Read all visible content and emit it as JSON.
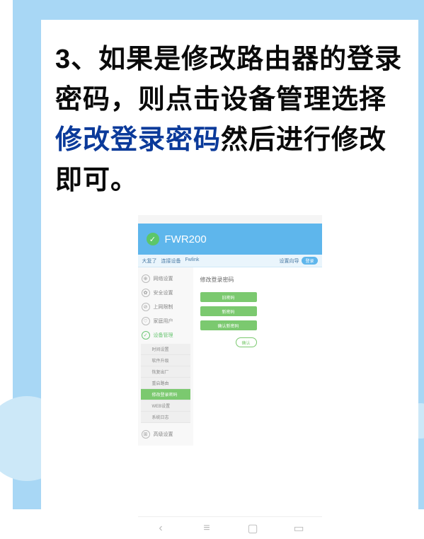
{
  "instruction": {
    "prefix": "3、如果是修改路由器的登录密码，则点击设备管理选择",
    "highlight": "修改登录密码",
    "suffix": "然后进行修改即可。"
  },
  "screenshot": {
    "device_name": "FWR200",
    "nav_left_1": "大复了",
    "nav_left_2": "连接设备",
    "nav_left_3": "Fwlink",
    "nav_right_text": "设置向导",
    "sidebar": {
      "item1": "网络设置",
      "item2": "安全设置",
      "item3": "上网限制",
      "item4": "家庭用户",
      "item5": "设备管理",
      "sub1": "时间设置",
      "sub2": "软件升级",
      "sub3": "恢复出厂",
      "sub4": "重启路由",
      "sub5": "修改登录密码",
      "sub6": "WEB设置",
      "sub7": "系统日志",
      "item6": "高级设置"
    },
    "content": {
      "title": "修改登录密码",
      "input1": "旧密码",
      "input2": "新密码",
      "input3": "确认新密码",
      "confirm": "确认"
    }
  }
}
